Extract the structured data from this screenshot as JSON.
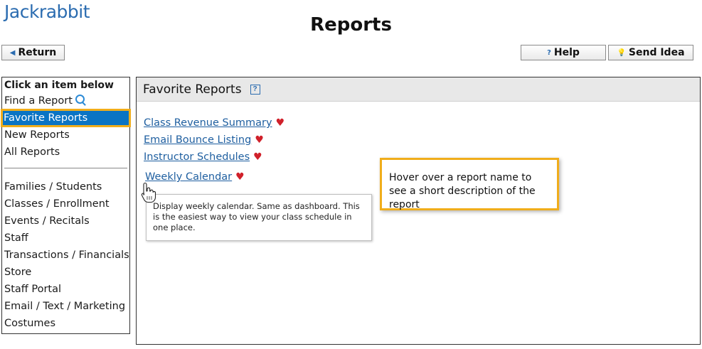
{
  "app": {
    "logo": "Jackrabbit",
    "page_title": "Reports"
  },
  "toolbar": {
    "return_label": "Return",
    "help_label": "Help",
    "send_idea_label": "Send Idea",
    "return_icon": "triangle-left-icon",
    "help_icon": "question-icon",
    "idea_icon": "lightbulb-icon"
  },
  "sidebar": {
    "header": "Click an item below",
    "top_items": [
      {
        "label": "Find a Report",
        "icon": "search-icon"
      },
      {
        "label": "Favorite Reports",
        "selected": true
      },
      {
        "label": "New Reports"
      },
      {
        "label": "All Reports"
      }
    ],
    "categories": [
      "Families / Students",
      "Classes / Enrollment",
      "Events / Recitals",
      "Staff",
      "Transactions / Financials",
      "Store",
      "Staff Portal",
      "Email / Text / Marketing",
      "Costumes"
    ]
  },
  "main": {
    "title": "Favorite Reports",
    "help_icon_glyph": "?",
    "reports": [
      "Class Revenue Summary",
      "Email Bounce Listing",
      "Instructor Schedules",
      "Weekly Calendar"
    ],
    "tooltip": "Display weekly calendar. Same as dashboard. This is the easiest way to view your class schedule in one place."
  },
  "callout": {
    "text": "Hover over a report name to see a short description of the report"
  },
  "colors": {
    "accent": "#0a74c4",
    "highlight": "#f0ad1b",
    "link": "#1f5fa0",
    "heart": "#d0202a"
  }
}
